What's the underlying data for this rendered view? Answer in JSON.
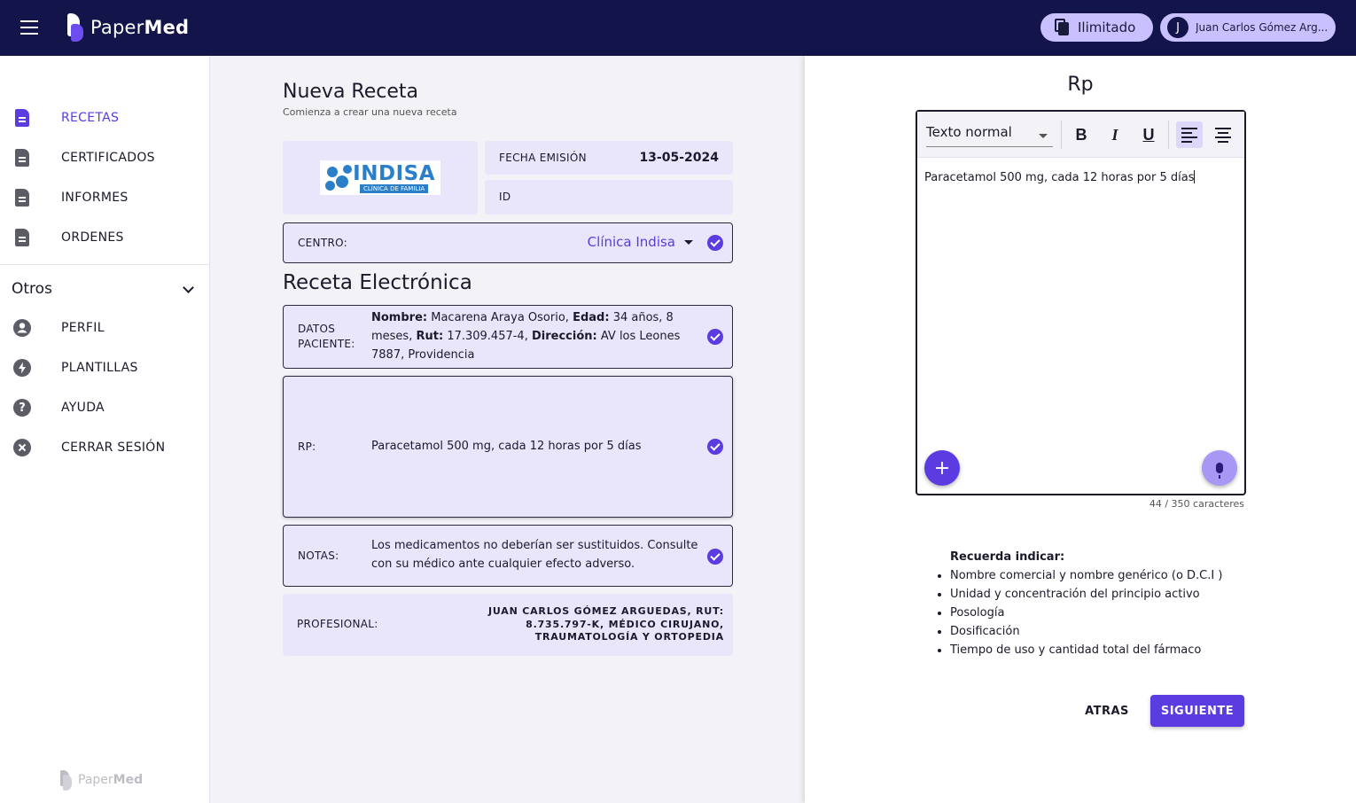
{
  "header": {
    "brand_light": "Paper",
    "brand_bold": "Med",
    "plan_label": "Ilimitado",
    "user_initial": "J",
    "user_name": "Juan Carlos Gómez Arg..."
  },
  "sidebar": {
    "items": [
      {
        "label": "RECETAS",
        "icon": "document-icon",
        "active": true
      },
      {
        "label": "CERTIFICADOS",
        "icon": "document-icon"
      },
      {
        "label": "INFORMES",
        "icon": "document-icon"
      },
      {
        "label": "ORDENES",
        "icon": "document-icon"
      }
    ],
    "otros_label": "Otros",
    "otros_items": [
      {
        "label": "PERFIL",
        "icon": "account-circle-icon"
      },
      {
        "label": "PLANTILLAS",
        "icon": "bolt-icon"
      },
      {
        "label": "AYUDA",
        "icon": "help-icon"
      },
      {
        "label": "CERRAR SESIÓN",
        "icon": "cancel-icon"
      }
    ],
    "footer_brand_light": "Paper",
    "footer_brand_bold": "Med"
  },
  "form": {
    "title": "Nueva Receta",
    "subtitle": "Comienza a crear una nueva receta",
    "clinic_logo_text": "INDISA",
    "clinic_logo_tagline": "CLÍNICA DE FAMILIA",
    "fecha_label": "FECHA EMISIÓN",
    "fecha_value": "13-05-2024",
    "id_label": "ID",
    "centro_label": "CENTRO:",
    "centro_value": "Clínica Indisa",
    "section_title": "Receta Electrónica",
    "paciente_label": "DATOS PACIENTE:",
    "paciente": {
      "nombre_label": "Nombre:",
      "nombre": "Macarena Araya Osorio,",
      "edad_label": "Edad:",
      "edad": "34 años, 8 meses,",
      "rut_label": "Rut:",
      "rut": "17.309.457-4,",
      "direccion_label": "Dirección:",
      "direccion": "AV los Leones 7887, Providencia"
    },
    "rp_label": "RP:",
    "rp_value": "Paracetamol 500 mg, cada 12 horas por 5 días",
    "notas_label": "NOTAS:",
    "notas_value": "Los medicamentos no deberían ser sustituidos. Consulte con su médico ante cualquier efecto adverso.",
    "profesional_label": "PROFESIONAL:",
    "profesional_value": "JUAN CARLOS GÓMEZ ARGUEDAS, RUT: 8.735.797-K, MÉDICO CIRUJANO, TRAUMATOLOGÍA Y ORTOPEDIA"
  },
  "editor": {
    "title": "Rp",
    "style_select": "Texto normal",
    "bold_label": "B",
    "italic_label": "I",
    "underline_label": "U",
    "content": "Paracetamol 500 mg, cada 12 horas por 5 días",
    "counter": "44 / 350 caracteres",
    "add_label": "+"
  },
  "reminder": {
    "title": "Recuerda indicar:",
    "items": [
      "Nombre comercial y nombre genérico (o D.C.I )",
      "Unidad y concentración del principio activo",
      "Posología",
      "Dosificación",
      "Tiempo de uso y cantidad total del fármaco"
    ]
  },
  "actions": {
    "back_label": "ATRAS",
    "next_label": "SIGUIENTE"
  },
  "colors": {
    "header_bg": "#12144a",
    "accent": "#5b3ce0",
    "chip_bg": "#c9c0ff",
    "card_bg": "#e9e6fb"
  }
}
